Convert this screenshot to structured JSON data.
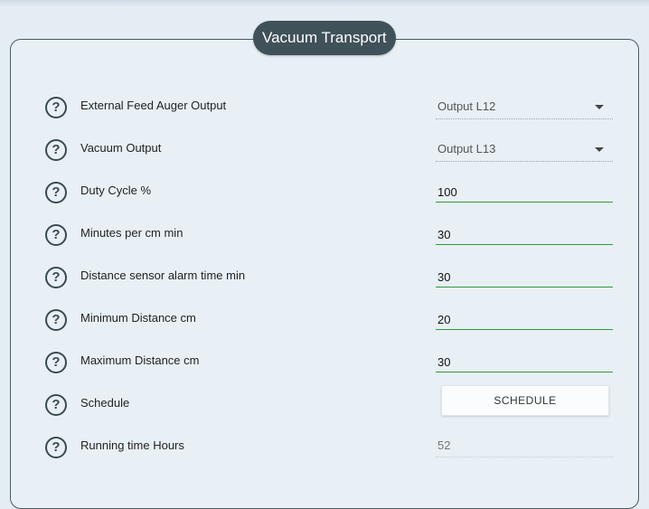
{
  "panel": {
    "title": "Vacuum Transport",
    "rows": [
      {
        "label": "External Feed Auger Output",
        "type": "select",
        "value": "Output L12"
      },
      {
        "label": "Vacuum Output",
        "type": "select",
        "value": "Output L13"
      },
      {
        "label": "Duty Cycle %",
        "type": "input",
        "value": "100"
      },
      {
        "label": "Minutes per cm min",
        "type": "input",
        "value": "30"
      },
      {
        "label": "Distance sensor alarm time min",
        "type": "input",
        "value": "30"
      },
      {
        "label": "Minimum Distance cm",
        "type": "input",
        "value": "20"
      },
      {
        "label": "Maximum Distance cm",
        "type": "input",
        "value": "30"
      },
      {
        "label": "Schedule",
        "type": "button",
        "value": "SCHEDULE"
      },
      {
        "label": "Running time Hours",
        "type": "readonly",
        "value": "52"
      }
    ]
  },
  "icons": {
    "help": "question-circle-icon",
    "dropdown": "caret-down-icon"
  },
  "help_glyph": "?",
  "colors": {
    "accent_underline": "#2e9a3e",
    "title_bg": "#3f5159"
  }
}
